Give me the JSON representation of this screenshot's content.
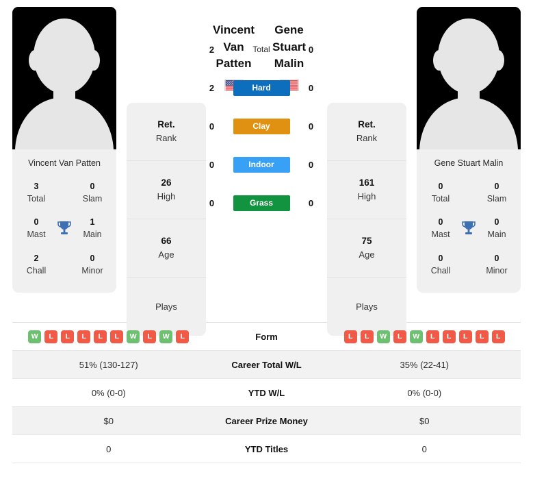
{
  "colors": {
    "hard": "#0d6ebd",
    "clay": "#e09112",
    "indoor": "#38a0f5",
    "grass": "#12933f",
    "win": "#6cc070",
    "loss": "#f05a46",
    "trophy": "#3c6fb4",
    "card_bg": "#f0f0f0"
  },
  "players": {
    "left": {
      "name_line1": "Vincent Van",
      "name_line2": "Patten",
      "card_name": "Vincent Van Patten",
      "country": "United States",
      "flag": "us-flag-icon",
      "titles": [
        {
          "value": "3",
          "label": "Total"
        },
        {
          "value": "0",
          "label": "Slam"
        },
        {
          "value": "0",
          "label": "Mast"
        },
        {
          "value": "1",
          "label": "Main"
        },
        {
          "value": "2",
          "label": "Chall"
        },
        {
          "value": "0",
          "label": "Minor"
        }
      ],
      "ranking": [
        {
          "value": "Ret.",
          "label": "Rank"
        },
        {
          "value": "26",
          "label": "High"
        },
        {
          "value": "66",
          "label": "Age"
        },
        {
          "value": "",
          "label": "Plays"
        }
      ],
      "form": [
        "W",
        "L",
        "L",
        "L",
        "L",
        "L",
        "W",
        "L",
        "W",
        "L"
      ]
    },
    "right": {
      "name_line1": "Gene Stuart",
      "name_line2": "Malin",
      "card_name": "Gene Stuart Malin",
      "country": "United States",
      "flag": "us-flag-icon",
      "titles": [
        {
          "value": "0",
          "label": "Total"
        },
        {
          "value": "0",
          "label": "Slam"
        },
        {
          "value": "0",
          "label": "Mast"
        },
        {
          "value": "0",
          "label": "Main"
        },
        {
          "value": "0",
          "label": "Chall"
        },
        {
          "value": "0",
          "label": "Minor"
        }
      ],
      "ranking": [
        {
          "value": "Ret.",
          "label": "Rank"
        },
        {
          "value": "161",
          "label": "High"
        },
        {
          "value": "75",
          "label": "Age"
        },
        {
          "value": "",
          "label": "Plays"
        }
      ],
      "form": [
        "L",
        "L",
        "W",
        "L",
        "W",
        "L",
        "L",
        "L",
        "L",
        "L"
      ]
    }
  },
  "surfaces": [
    {
      "label": "Total",
      "left": "2",
      "right": "0",
      "style": "plain"
    },
    {
      "label": "Hard",
      "left": "2",
      "right": "0",
      "style": "hard"
    },
    {
      "label": "Clay",
      "left": "0",
      "right": "0",
      "style": "clay"
    },
    {
      "label": "Indoor",
      "left": "0",
      "right": "0",
      "style": "indoor"
    },
    {
      "label": "Grass",
      "left": "0",
      "right": "0",
      "style": "grass"
    }
  ],
  "stats_table": {
    "form_label": "Form",
    "rows": [
      {
        "label": "Career Total W/L",
        "left": "51% (130-127)",
        "right": "35% (22-41)"
      },
      {
        "label": "YTD W/L",
        "left": "0% (0-0)",
        "right": "0% (0-0)"
      },
      {
        "label": "Career Prize Money",
        "left": "$0",
        "right": "$0"
      },
      {
        "label": "YTD Titles",
        "left": "0",
        "right": "0"
      }
    ]
  }
}
